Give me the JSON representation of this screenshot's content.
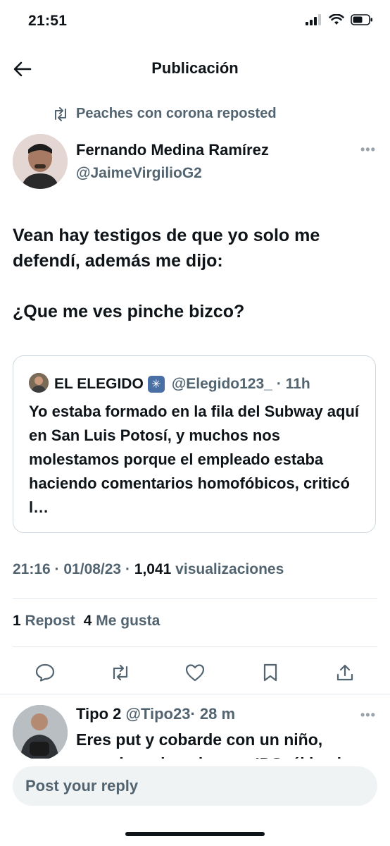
{
  "status": {
    "time": "21:51"
  },
  "header": {
    "title": "Publicación"
  },
  "repost": {
    "label": "Peaches con corona reposted"
  },
  "post": {
    "author_name": "Fernando Medina Ramírez",
    "author_handle": "@JaimeVirgilioG2",
    "text": "Vean hay testigos de que yo solo me defendí, además me dijo:\n\n¿Que me ves pinche bizco?",
    "quote": {
      "name": "EL ELEGIDO",
      "badge": "✳",
      "handle": "@Elegido123_",
      "time": "· 11h",
      "text": "Yo estaba formado en la fila del Subway aquí en San Luis Potosí, y muchos nos molestamos porque el empleado estaba haciendo comentarios homofóbicos, criticó l…"
    },
    "meta_time": "21:16 · 01/08/23 · ",
    "views_count": "1,041",
    "views_label": " visualizaciones",
    "reposts_count": "1",
    "reposts_label": "Repost",
    "likes_count": "4",
    "likes_label": "Me gusta"
  },
  "reply": {
    "name": "Tipo 2",
    "handle": "@Tipo23",
    "time": "· 28 m",
    "text": "Eres put y cobarde con un niño,",
    "text_cut": "cuando se le quiso ser IDS, él lo vio"
  },
  "composer": {
    "placeholder": "Post your reply"
  },
  "icons": [
    "back-arrow-icon",
    "repost-icon",
    "reply-icon",
    "like-icon",
    "bookmark-icon",
    "share-icon",
    "more-icon"
  ]
}
